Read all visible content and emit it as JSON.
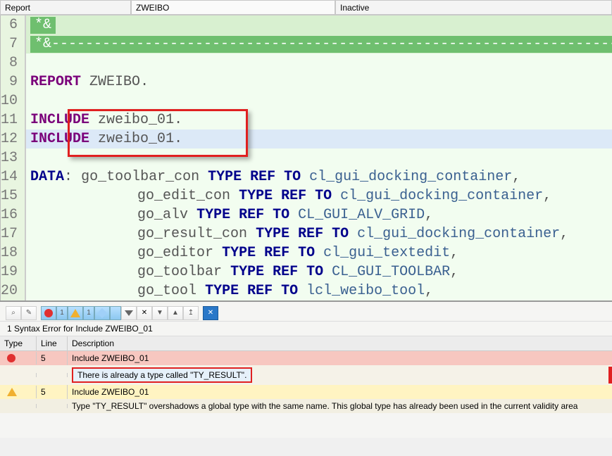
{
  "header": {
    "object_type_label": "Report",
    "object_name": "ZWEIBO",
    "status": "Inactive"
  },
  "editor": {
    "lines": [
      {
        "n": 6,
        "type": "comment",
        "text": "*&"
      },
      {
        "n": 7,
        "type": "comment-dash",
        "text": "*&"
      },
      {
        "n": 8,
        "type": "blank",
        "text": " "
      },
      {
        "n": 9,
        "type": "report",
        "kw": "REPORT",
        "ident": "ZWEIBO",
        "tail": "."
      },
      {
        "n": 10,
        "type": "blank",
        "text": " "
      },
      {
        "n": 11,
        "type": "include",
        "kw": "INCLUDE",
        "ident": "zweibo_01",
        "tail": "."
      },
      {
        "n": 12,
        "type": "include",
        "kw": "INCLUDE",
        "ident": "zweibo_01",
        "tail": ".",
        "sel": true
      },
      {
        "n": 13,
        "type": "blank",
        "text": " "
      },
      {
        "n": 14,
        "type": "data-head",
        "kw": "DATA",
        "colon": ":",
        "var": "go_toolbar_con",
        "ref": "TYPE REF TO",
        "cls": "cl_gui_docking_container",
        "tail": ","
      },
      {
        "n": 15,
        "type": "data-cont",
        "var": "go_edit_con",
        "ref": "TYPE REF TO",
        "cls": "cl_gui_docking_container",
        "tail": ","
      },
      {
        "n": 16,
        "type": "data-cont",
        "var": "go_alv",
        "ref": "TYPE REF TO",
        "cls": "CL_GUI_ALV_GRID",
        "tail": ","
      },
      {
        "n": 17,
        "type": "data-cont",
        "var": "go_result_con",
        "ref": "TYPE REF TO",
        "cls": "cl_gui_docking_container",
        "tail": ","
      },
      {
        "n": 18,
        "type": "data-cont",
        "var": "go_editor",
        "ref": "TYPE REF TO",
        "cls": "cl_gui_textedit",
        "tail": ","
      },
      {
        "n": 19,
        "type": "data-cont",
        "var": "go_toolbar",
        "ref": "TYPE REF TO",
        "cls": "CL_GUI_TOOLBAR",
        "tail": ","
      },
      {
        "n": 20,
        "type": "data-cont",
        "var": "go_tool",
        "ref": "TYPE REF TO",
        "cls": "lcl_weibo_tool",
        "tail": ","
      }
    ]
  },
  "problems": {
    "summary": "1 Syntax Error for Include ZWEIBO_01",
    "toolbar": {
      "count1": "1",
      "count2": "1"
    },
    "columns": {
      "type": "Type",
      "line": "Line",
      "desc": "Description"
    },
    "rows": [
      {
        "kind": "error-head",
        "line": "5",
        "desc": "Include ZWEIBO_01"
      },
      {
        "kind": "error-msg",
        "desc": "There is already a type called \"TY_RESULT\"."
      },
      {
        "kind": "warn-head",
        "line": "5",
        "desc": "Include ZWEIBO_01"
      },
      {
        "kind": "warn-msg",
        "desc": "Type \"TY_RESULT\" overshadows a global type with the same name. This global type has already been used in the current validity area"
      }
    ]
  }
}
